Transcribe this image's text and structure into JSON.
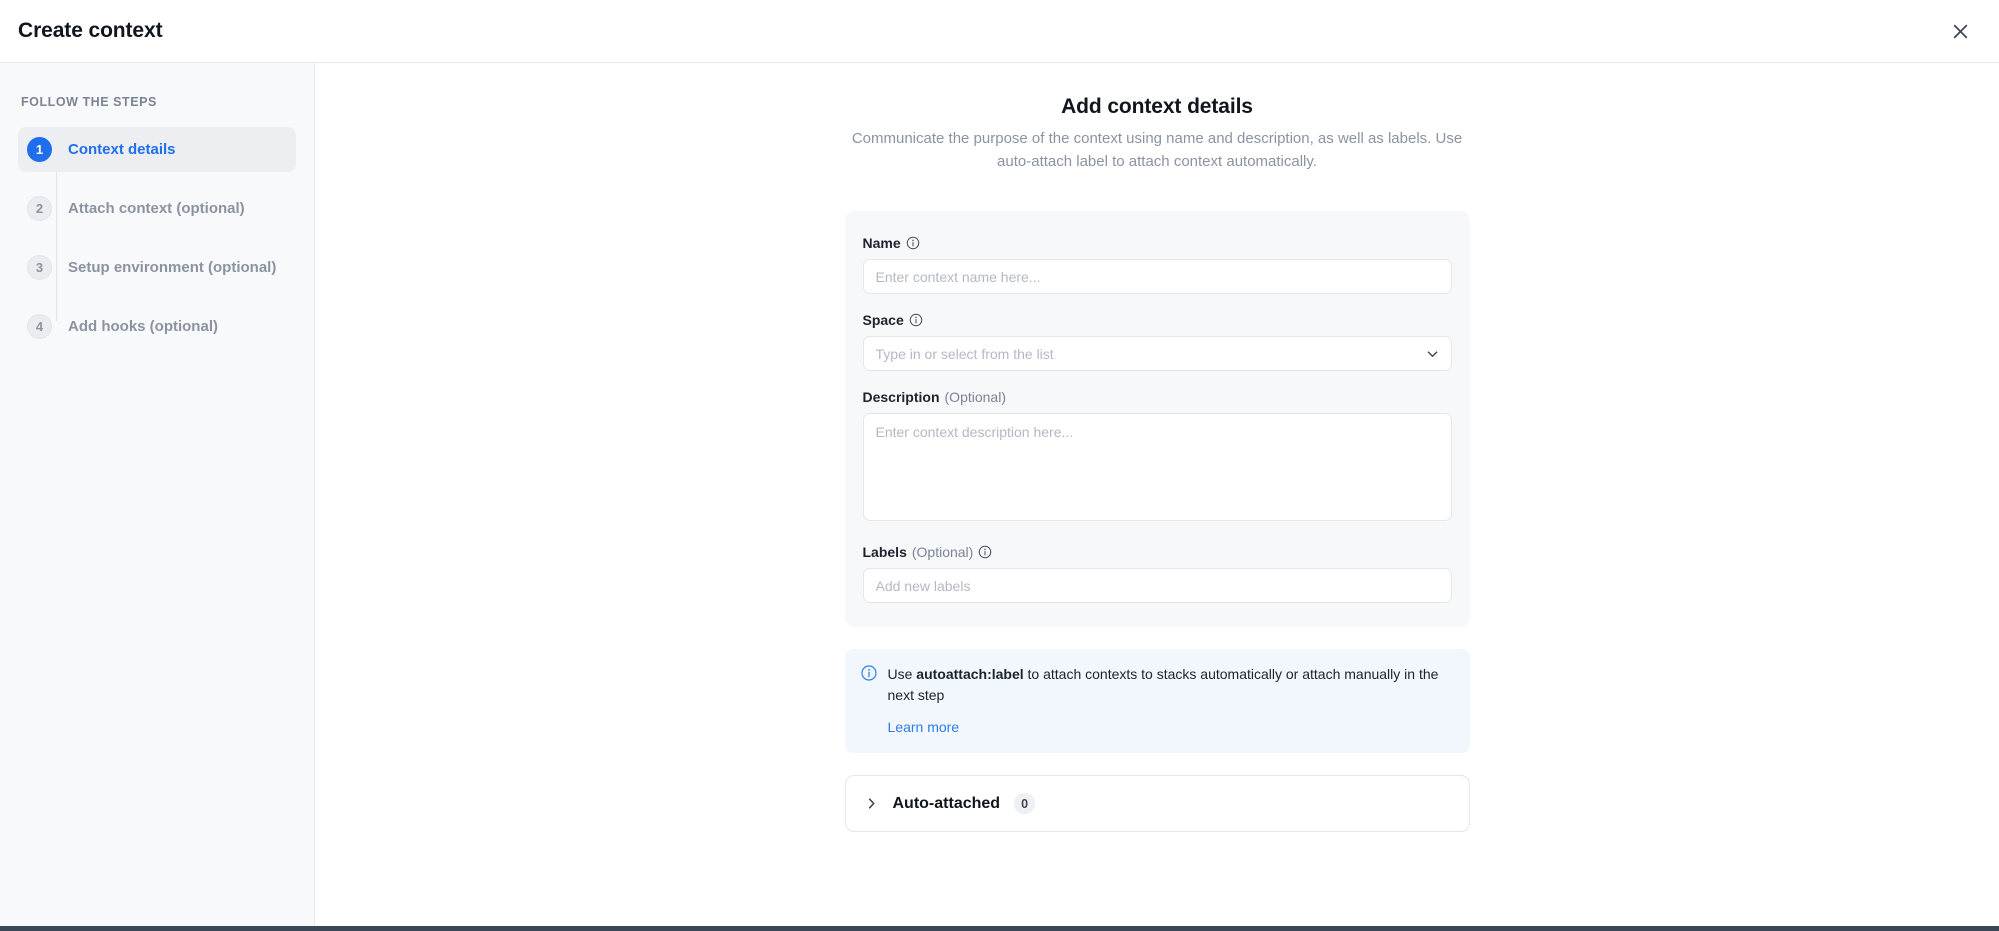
{
  "window": {
    "title": "Create context",
    "close_icon": "close-icon"
  },
  "sidebar": {
    "heading": "FOLLOW THE STEPS",
    "steps": [
      {
        "number": "1",
        "label": "Context details",
        "active": true
      },
      {
        "number": "2",
        "label": "Attach context (optional)",
        "active": false
      },
      {
        "number": "3",
        "label": "Setup environment (optional)",
        "active": false
      },
      {
        "number": "4",
        "label": "Add hooks (optional)",
        "active": false
      }
    ]
  },
  "main": {
    "title": "Add context details",
    "subtitle": "Communicate the purpose of the context using name and description, as well as labels. Use auto-attach label to attach context automatically.",
    "fields": {
      "name": {
        "label": "Name",
        "info_icon": "info-icon",
        "placeholder": "Enter context name here...",
        "value": ""
      },
      "space": {
        "label": "Space",
        "info_icon": "info-icon",
        "placeholder": "Type in or select from the list",
        "value": "",
        "chevron_icon": "chevron-down-icon"
      },
      "description": {
        "label": "Description",
        "optional": "(Optional)",
        "placeholder": "Enter context description here...",
        "value": ""
      },
      "labels": {
        "label": "Labels",
        "optional": "(Optional)",
        "info_icon": "info-icon",
        "placeholder": "Add new labels",
        "value": ""
      }
    },
    "banner": {
      "icon": "info-circle-icon",
      "text_before": "Use ",
      "text_bold": "autoattach:label",
      "text_after": " to attach contexts to stacks automatically or attach manually in the next step",
      "link": "Learn more"
    },
    "accordion": {
      "chevron_icon": "chevron-right-icon",
      "title": "Auto-attached",
      "count": "0"
    }
  },
  "colors": {
    "accent": "#1f6feb",
    "link": "#2b7de9",
    "sidebar_bg": "#f8f9fb",
    "card_bg": "#f7f8fa",
    "banner_bg": "#f2f7fe"
  }
}
